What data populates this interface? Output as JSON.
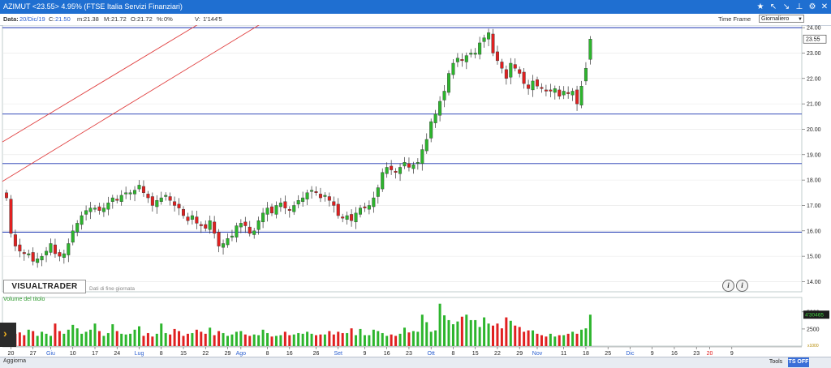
{
  "window": {
    "title": "AZIMUT <23.55> 4.95%  (FTSE Italia Servizi Finanziari)",
    "icons": [
      "star-icon",
      "crosshair-arrow-icon",
      "draw-line-icon",
      "pin-icon",
      "settings-icon",
      "close-icon"
    ]
  },
  "info": {
    "data_label": "Data:",
    "data_value": "20/Dic/19",
    "c_label": "C:",
    "c_value": "21.50",
    "m_label": "m:",
    "m_value": "21.38",
    "max_label": "M:",
    "max_value": "21.72",
    "o_label": "O:",
    "o_value": "21.72",
    "pct_label": "%:",
    "pct_value": "0%",
    "v_label": "V:",
    "v_value": "1'144'5"
  },
  "timeframe": {
    "label": "Time Frame",
    "selected": "Giornaliero"
  },
  "logo": "VISUALTRADER",
  "note": "Dati di fine giornata",
  "info_buttons": [
    "i",
    "i"
  ],
  "volume": {
    "label": "Volume del titolo",
    "current_badge": "4'30465",
    "multiplier": "x1000"
  },
  "bottom": {
    "aggiorna": "Aggiorna",
    "tools": "Tools",
    "tsoff": "TS OFF"
  },
  "colors": {
    "up": "#2db52d",
    "down": "#e02020",
    "hline": "#1a33b0",
    "trend": "#e04040",
    "titlebar": "#1f6fd1"
  },
  "chart_data": {
    "type": "candlestick",
    "instrument": "AZIMUT",
    "last_price": "23.55",
    "price_axis": {
      "min": 13.6,
      "max": 24.1,
      "ticks": [
        "14.00",
        "15.00",
        "16.00",
        "17.00",
        "18.00",
        "19.00",
        "20.00",
        "21.00",
        "22.00",
        "23.00",
        "24.00"
      ]
    },
    "volume_axis": {
      "ticks": [
        "2500",
        "5000"
      ],
      "max": 6400
    },
    "x_ticks": [
      {
        "label": "20",
        "i": 1
      },
      {
        "label": "27",
        "i": 6
      },
      {
        "label": "Giu",
        "i": 10,
        "month": true
      },
      {
        "label": "10",
        "i": 15
      },
      {
        "label": "17",
        "i": 20
      },
      {
        "label": "24",
        "i": 25
      },
      {
        "label": "Lug",
        "i": 30,
        "month": true
      },
      {
        "label": "8",
        "i": 35
      },
      {
        "label": "15",
        "i": 40
      },
      {
        "label": "22",
        "i": 45
      },
      {
        "label": "29",
        "i": 50
      },
      {
        "label": "Ago",
        "i": 53,
        "month": true
      },
      {
        "label": "8",
        "i": 59
      },
      {
        "label": "16",
        "i": 64
      },
      {
        "label": "26",
        "i": 70
      },
      {
        "label": "Set",
        "i": 75,
        "month": true
      },
      {
        "label": "9",
        "i": 81
      },
      {
        "label": "16",
        "i": 86
      },
      {
        "label": "23",
        "i": 91
      },
      {
        "label": "Ott",
        "i": 96,
        "month": true
      },
      {
        "label": "8",
        "i": 101
      },
      {
        "label": "15",
        "i": 106
      },
      {
        "label": "22",
        "i": 111
      },
      {
        "label": "29",
        "i": 116
      },
      {
        "label": "Nov",
        "i": 120,
        "month": true
      },
      {
        "label": "11",
        "i": 126
      },
      {
        "label": "18",
        "i": 131
      },
      {
        "label": "25",
        "i": 136
      },
      {
        "label": "Dic",
        "i": 141,
        "month": true
      },
      {
        "label": "9",
        "i": 146
      },
      {
        "label": "16",
        "i": 151
      },
      {
        "label": "23",
        "i": 156
      },
      {
        "label": "20",
        "i": 159,
        "red": true
      },
      {
        "label": "9",
        "i": 164
      }
    ],
    "horizontal_lines": [
      24.0,
      20.6,
      18.65,
      15.95
    ],
    "trend_lines": [
      {
        "x0": 0,
        "y0": 19.5,
        "x1": 44,
        "y1": 24.2
      },
      {
        "x0": 0,
        "y0": 17.95,
        "x1": 58,
        "y1": 24.2
      }
    ],
    "ohlc_close": [
      17.3,
      15.9,
      15.4,
      15.2,
      15.1,
      15.1,
      14.8,
      14.9,
      15.0,
      15.2,
      15.5,
      15.1,
      15.0,
      15.1,
      15.5,
      16.0,
      16.3,
      16.6,
      16.8,
      16.9,
      16.9,
      16.8,
      16.9,
      17.1,
      17.3,
      17.2,
      17.4,
      17.5,
      17.5,
      17.6,
      17.8,
      17.5,
      17.3,
      17.0,
      17.2,
      17.3,
      17.4,
      17.2,
      17.0,
      16.9,
      16.6,
      16.4,
      16.6,
      16.3,
      16.2,
      16.1,
      16.4,
      15.9,
      15.4,
      15.5,
      15.7,
      15.8,
      16.2,
      16.3,
      16.2,
      15.9,
      16.0,
      16.4,
      16.7,
      16.9,
      16.7,
      17.0,
      17.1,
      16.9,
      16.8,
      17.0,
      17.2,
      17.3,
      17.5,
      17.6,
      17.5,
      17.3,
      17.4,
      17.2,
      17.0,
      16.6,
      16.5,
      16.6,
      16.4,
      16.7,
      16.9,
      16.9,
      17.0,
      17.3,
      17.7,
      18.3,
      18.5,
      18.4,
      18.3,
      18.5,
      18.7,
      18.5,
      18.6,
      18.7,
      19.2,
      19.6,
      20.3,
      20.6,
      21.1,
      21.5,
      22.2,
      22.6,
      22.8,
      22.7,
      22.9,
      23.0,
      23.0,
      23.4,
      23.6,
      23.8,
      23.0,
      22.7,
      22.4,
      22.0,
      22.6,
      22.4,
      22.2,
      21.8,
      21.6,
      21.9,
      21.7,
      21.6,
      21.5,
      21.5,
      21.6,
      21.3,
      21.5,
      21.4,
      21.5,
      21.0,
      21.7,
      22.4,
      23.55
    ],
    "volume_values": [
      1600,
      2200,
      1800,
      2000,
      1600,
      2400,
      2200,
      1500,
      2100,
      1800,
      1500,
      3300,
      2200,
      1800,
      2400,
      3100,
      2600,
      1800,
      2100,
      2400,
      3300,
      2200,
      1500,
      1900,
      3200,
      2200,
      1800,
      1700,
      1800,
      2400,
      2900,
      1500,
      1900,
      1400,
      1800,
      3300,
      1900,
      1700,
      2500,
      2200,
      1500,
      1800,
      1900,
      2400,
      2100,
      1800,
      2700,
      1600,
      2200,
      1900,
      1500,
      1700,
      2100,
      2200,
      1700,
      1500,
      1700,
      1600,
      2400,
      1900,
      1400,
      1500,
      1600,
      2100,
      1600,
      1700,
      1900,
      1800,
      2100,
      1800,
      1600,
      1700,
      1700,
      2200,
      1700,
      2100,
      1900,
      1900,
      2600,
      1600,
      2500,
      1600,
      1600,
      2400,
      2200,
      1900,
      1500,
      1700,
      1500,
      1800,
      2700,
      2000,
      2200,
      2100,
      4600,
      3500,
      2100,
      2300,
      6200,
      4500,
      3800,
      3200,
      3600,
      4300,
      4600,
      3800,
      3800,
      2800,
      4200,
      3300,
      3000,
      3300,
      2600,
      4200,
      3700,
      3000,
      2800,
      2100,
      2300,
      2300,
      1800,
      1600,
      1400,
      1800,
      1400,
      1600,
      1600,
      1800,
      2100,
      1800,
      2400,
      2600,
      4600
    ],
    "down_days_sample": "derived from close vs previous close"
  }
}
